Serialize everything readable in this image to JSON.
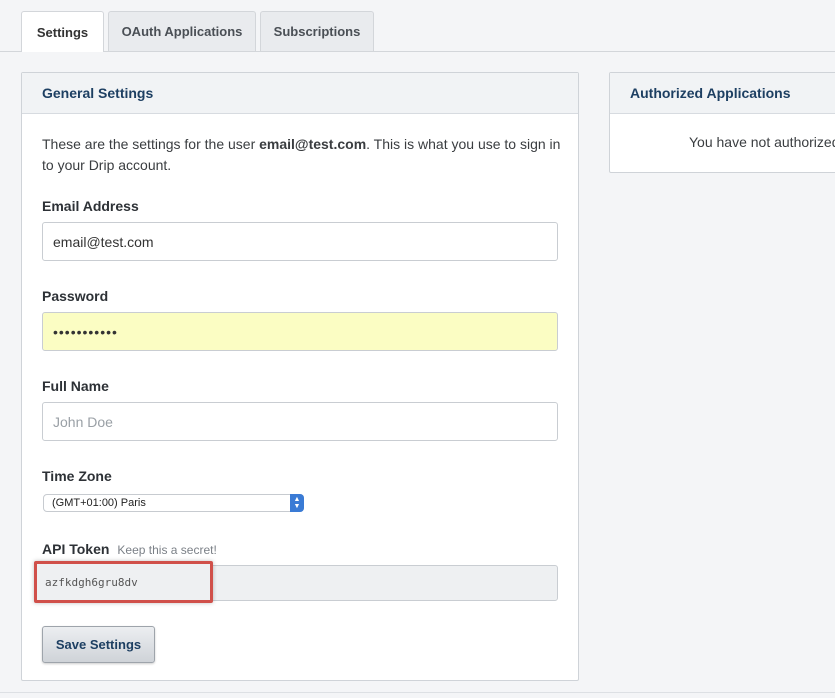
{
  "tabs": [
    {
      "label": "Settings",
      "active": true
    },
    {
      "label": "OAuth Applications",
      "active": false
    },
    {
      "label": "Subscriptions",
      "active": false
    }
  ],
  "general": {
    "title": "General Settings",
    "intro_prefix": "These are the settings for the user ",
    "intro_email": "email@test.com",
    "intro_suffix": ". This is what you use to sign in to your Drip account.",
    "email_label": "Email Address",
    "email_value": "email@test.com",
    "password_label": "Password",
    "password_value": "•••••••••••",
    "fullname_label": "Full Name",
    "fullname_placeholder": "John Doe",
    "timezone_label": "Time Zone",
    "timezone_value": "(GMT+01:00) Paris",
    "api_label": "API Token",
    "api_hint": "Keep this a secret!",
    "api_value": "azfkdgh6gru8dv",
    "save_label": "Save Settings"
  },
  "authorized": {
    "title": "Authorized Applications",
    "message": "You have not authorized"
  },
  "colors": {
    "heading": "#1d3f62",
    "highlight": "#d0504a",
    "password_bg": "#fbfdc3"
  }
}
